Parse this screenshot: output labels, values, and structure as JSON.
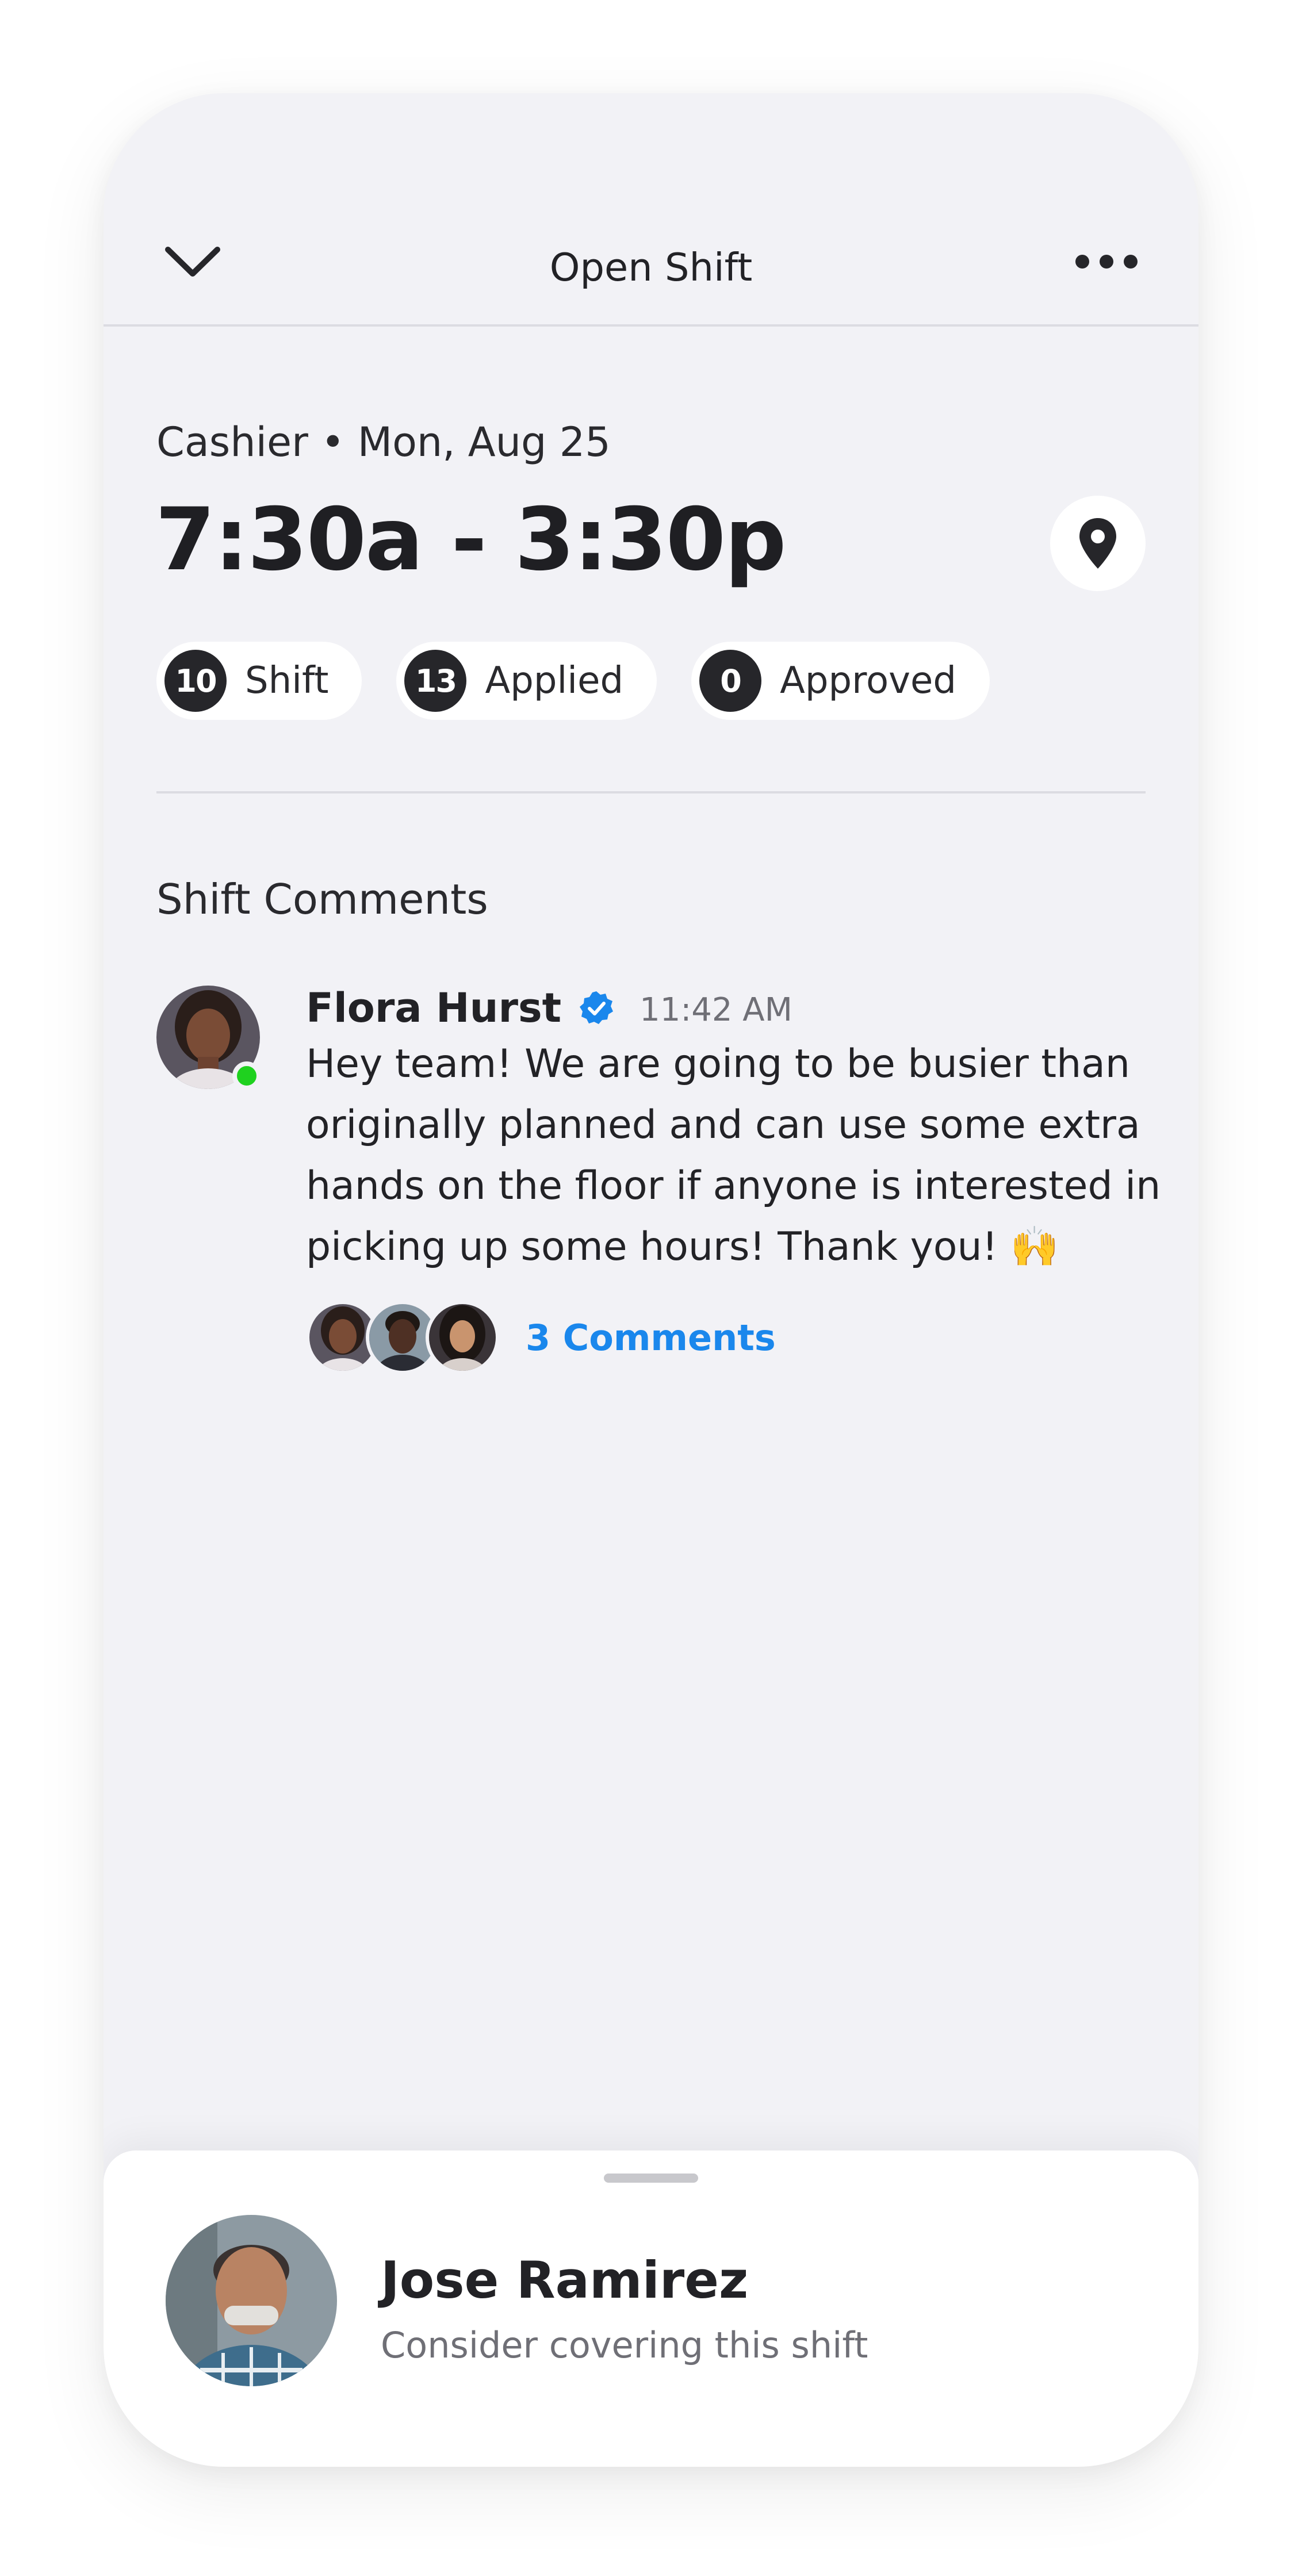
{
  "header": {
    "title": "Open Shift",
    "back_icon": "chevron-down-icon",
    "more_icon": "more-horizontal-icon"
  },
  "shift": {
    "subtitle": "Cashier • Mon, Aug 25",
    "time": "7:30a - 3:30p",
    "location_icon": "map-pin-icon",
    "stats": [
      {
        "count": "10",
        "label": "Shift"
      },
      {
        "count": "13",
        "label": "Applied"
      },
      {
        "count": "0",
        "label": "Approved"
      }
    ]
  },
  "comments": {
    "title": "Shift Comments",
    "items": [
      {
        "author": "Flora Hurst",
        "verified_icon": "verified-badge-icon",
        "time": "11:42 AM",
        "text": "Hey team! We are going to be busier than originally planned and can use some extra hands on the floor if anyone is interested in picking up some hours! Thank you! 🙌",
        "replies_label": "3 Comments"
      }
    ]
  },
  "sheet": {
    "name": "Jose Ramirez",
    "subtitle": "Consider covering this shift"
  },
  "colors": {
    "background": "#f2f2f6",
    "accent": "#1a87ec",
    "online": "#1fd11f",
    "chip_count_bg": "#26262a"
  }
}
